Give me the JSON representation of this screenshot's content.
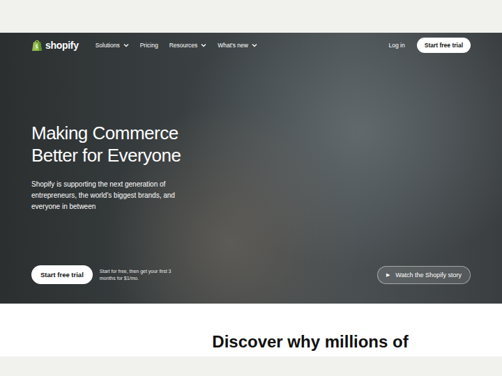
{
  "nav": {
    "logo": "shopify",
    "items": [
      {
        "label": "Solutions",
        "dropdown": true
      },
      {
        "label": "Pricing",
        "dropdown": false
      },
      {
        "label": "Resources",
        "dropdown": true
      },
      {
        "label": "What's new",
        "dropdown": true
      }
    ],
    "login": "Log in",
    "cta": "Start free trial"
  },
  "hero": {
    "title_lines": [
      "Making Commerce",
      "Better for Everyone"
    ],
    "subtitle": "Shopify is supporting the next generation of entrepreneurs, the world's biggest brands, and everyone in between",
    "cta": "Start free trial",
    "offer": "Start for free, then get your first 3 months for $1/mo.",
    "video_button": "Watch the Shopify story",
    "video_icon": "▶"
  },
  "next_section": {
    "heading": "Discover why millions of"
  }
}
